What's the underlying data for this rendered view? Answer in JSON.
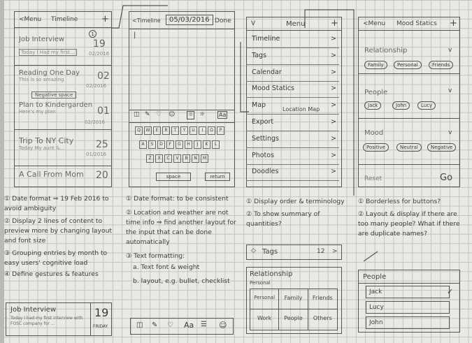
{
  "screen1": {
    "back": "<Menu",
    "title": "Timeline",
    "plus": "+",
    "entries": [
      {
        "title": "Job Interview",
        "sub": "Today I Had my first...",
        "day": "19",
        "date": "02/2016",
        "marker": "1"
      },
      {
        "title": "Reading One Day",
        "sub": "This is so amazing",
        "day": "02",
        "date": "02/2016"
      },
      {
        "title": "Plan to Kindergarden",
        "sub": "Here's my plan",
        "day": "01",
        "date": "02/2016"
      },
      {
        "title": "Trip To NY City",
        "sub": "Today My aunt &...",
        "day": "25",
        "date": "01/2016"
      },
      {
        "title": "A Call From Mom",
        "sub": "",
        "day": "20",
        "date": ""
      }
    ],
    "separator_label": "Negative space",
    "notes": [
      "① Date format ⇒ 19 Feb 2016 to avoid ambiguity",
      "② Display 2 lines of content to preview more by changing layout and font size",
      "③ Grouping entries by month to easy users' cognitive load",
      "④ Define gestures & features"
    ],
    "detail_card": {
      "title": "Job Interview",
      "body": "Today I had my first interview with FOSC company for ...",
      "day": "19",
      "weekday": "FRIDAY"
    }
  },
  "screen2": {
    "back": "<Timeline",
    "date": "05/03/2016",
    "done": "Done",
    "cursor": "|",
    "toolbar_icons": [
      "camera-icon",
      "pencil-icon",
      "heart-icon",
      "smiley-icon",
      "location-icon",
      "sun-icon",
      "text-format-icon"
    ],
    "text_format": "Aa",
    "keyboard_rows": [
      [
        "Q",
        "W",
        "E",
        "R",
        "T",
        "Y",
        "U",
        "I",
        "O",
        "P"
      ],
      [
        "A",
        "S",
        "D",
        "F",
        "G",
        "H",
        "J",
        "K",
        "L"
      ],
      [
        "Z",
        "X",
        "C",
        "V",
        "B",
        "N",
        "M"
      ]
    ],
    "space": "space",
    "return": "return",
    "notes": [
      "① Date format: to be consistent",
      "② Location and weather are not time info ⇒ find another layout for the input that can be done automatically",
      "③ Text formatting:",
      "a. Text font & weight",
      "b. layout, e.g. bullet, checklist"
    ],
    "format_bar": "Aa"
  },
  "screen3": {
    "close": "V",
    "title": "Menu",
    "plus": "+",
    "items": [
      "Timeline",
      "Tags",
      "Calendar",
      "Mood Statics",
      "Map",
      "Export",
      "Settings",
      "Photos",
      "Doodles"
    ],
    "map_note": "Location Map",
    "notes": [
      "① Display order & terminology",
      "② To show summary of quantities?"
    ],
    "tags_row": {
      "label": "Tags",
      "count": "12"
    },
    "relationship": {
      "title": "Relationship",
      "subtitle": "Personal",
      "cells": [
        "Personal",
        "Family",
        "Friends",
        "Work",
        "People",
        "Others"
      ]
    }
  },
  "screen4": {
    "back": "<Menu",
    "title": "Mood Statics",
    "plus": "+",
    "sections": [
      {
        "name": "Relationship",
        "pills": [
          "Family",
          "Personal",
          "Friends"
        ]
      },
      {
        "name": "People",
        "pills": [
          "Jack",
          "John",
          "Lucy"
        ]
      },
      {
        "name": "Mood",
        "pills": [
          "Positive",
          "Neutral",
          "Negative"
        ]
      }
    ],
    "reset": "Reset",
    "go": "Go",
    "notes": [
      "① Borderless for buttons?",
      "② Layout & display if there are too many people? What if there are duplicate names?"
    ],
    "people_list": {
      "title": "People",
      "items": [
        "Jack",
        "Lucy",
        "John"
      ],
      "check": "✓"
    }
  }
}
